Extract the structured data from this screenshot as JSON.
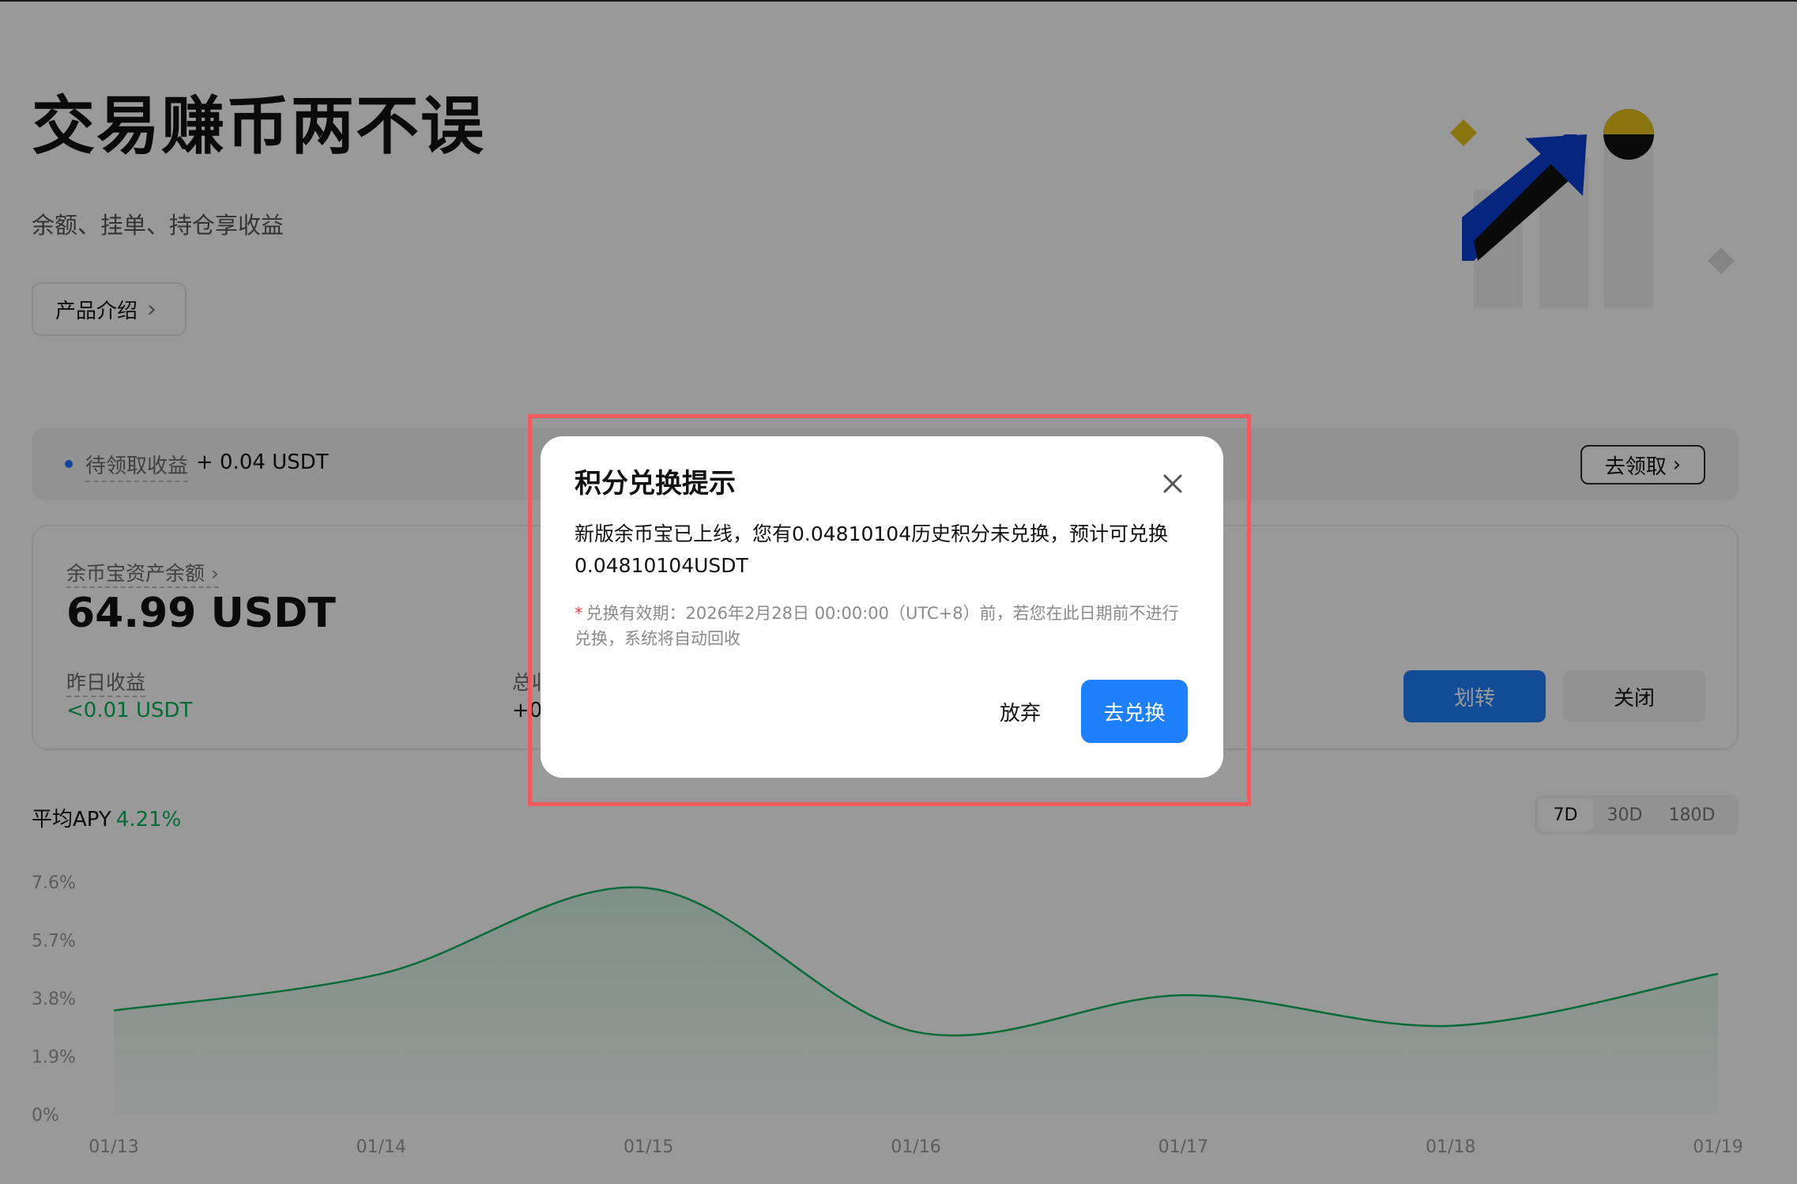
{
  "hero": {
    "title": "交易赚币两不误",
    "subtitle": "余额、挂单、持仓享收益",
    "intro_button": "产品介绍"
  },
  "claim": {
    "label": "待领取收益",
    "value": "+ 0.04 USDT",
    "button": "去领取"
  },
  "asset": {
    "label": "余币宝资产余额",
    "value": "64.99 USDT",
    "yesterday_label": "昨日收益",
    "yesterday_value": "<0.01 USDT",
    "total_label": "总收",
    "total_value": "+0.",
    "transfer_button": "划转",
    "close_button": "关闭"
  },
  "apy": {
    "title": "平均APY",
    "value": "4.21%",
    "ranges": [
      "7D",
      "30D",
      "180D"
    ],
    "selected_range": "7D"
  },
  "chart_data": {
    "type": "area",
    "x": [
      "01/13",
      "01/14",
      "01/15",
      "01/16",
      "01/17",
      "01/18",
      "01/19"
    ],
    "series": [
      {
        "values": [
          3.4,
          4.6,
          7.4,
          2.7,
          3.9,
          2.9,
          4.6
        ]
      }
    ],
    "y_ticks": [
      "7.6%",
      "5.7%",
      "3.8%",
      "1.9%",
      "0%"
    ],
    "ylim": [
      0,
      7.6
    ],
    "grid": false,
    "line_color": "#0bb35a"
  },
  "modal": {
    "title": "积分兑换提示",
    "body": "新版余币宝已上线，您有0.04810104历史积分未兑换，预计可兑换0.04810104USDT",
    "note_star": "*",
    "note": "兑换有效期：2026年2月28日 00:00:00（UTC+8）前，若您在此日期前不进行兑换，系统将自动回收",
    "abandon_button": "放弃",
    "redeem_button": "去兑换"
  },
  "colors": {
    "accent": "#1e7ffb",
    "positive": "#0bb35a",
    "highlight_border": "#ef5a5a"
  }
}
